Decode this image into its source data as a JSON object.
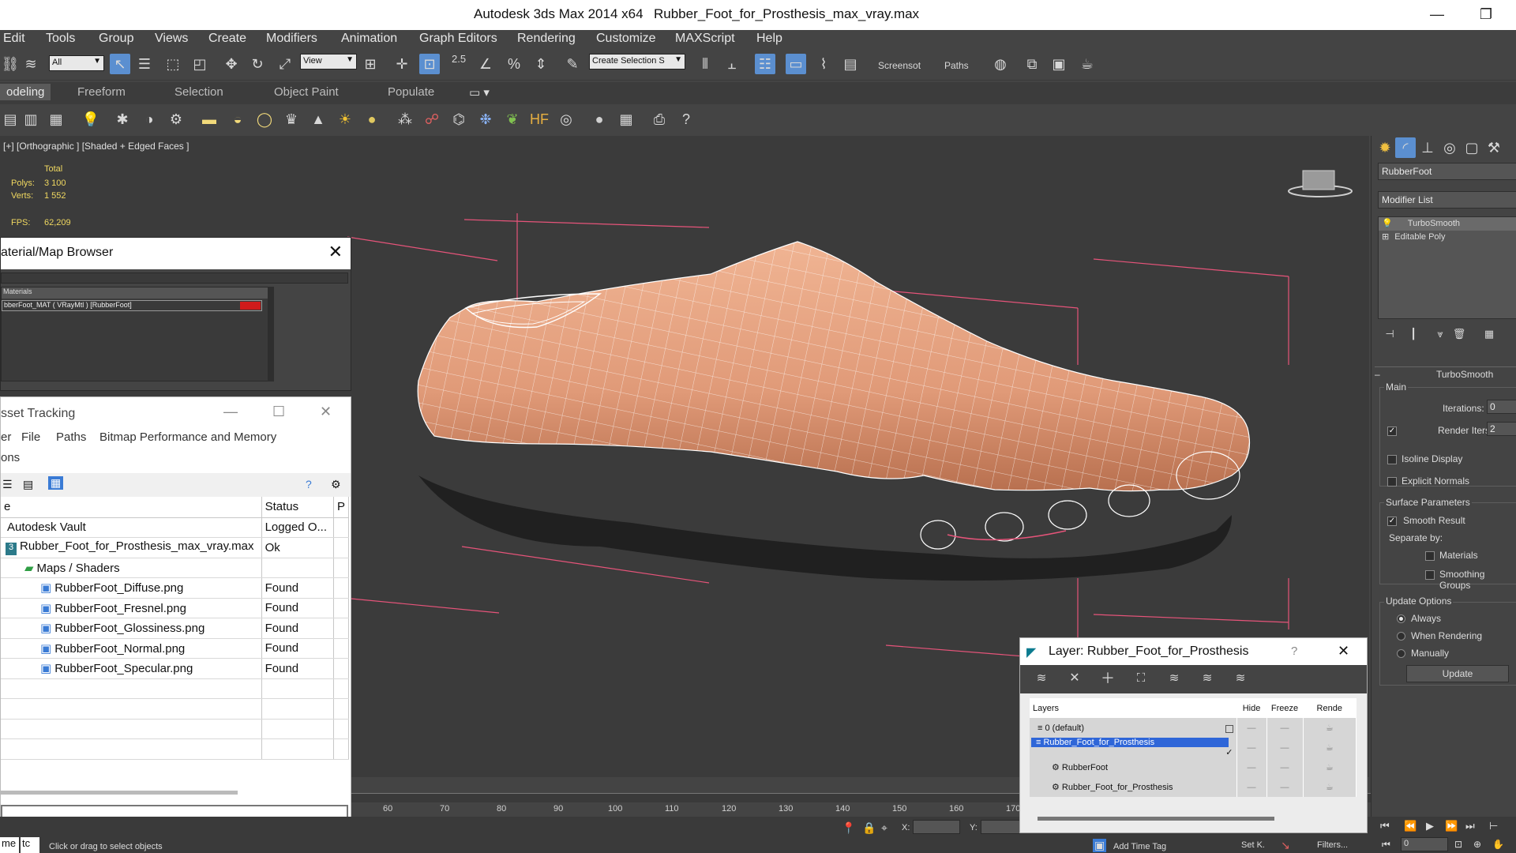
{
  "window": {
    "app_title": "Autodesk 3ds Max  2014 x64",
    "file_title": "Rubber_Foot_for_Prosthesis_max_vray.max",
    "minimize": "—",
    "maximize": "❐"
  },
  "menu": [
    "Edit",
    "Tools",
    "Group",
    "Views",
    "Create",
    "Modifiers",
    "Animation",
    "Graph Editors",
    "Rendering",
    "Customize",
    "MAXScript",
    "Help"
  ],
  "toolbar": {
    "selection_filter": "All",
    "reference_coord": "View",
    "named_selection": "Create Selection S",
    "snap_label": "2.5",
    "screenshot_label": "Screensot",
    "paths_label": "Paths"
  },
  "ribbon_tabs": [
    "odeling",
    "Freeform",
    "Selection",
    "Object Paint",
    "Populate"
  ],
  "viewport": {
    "label": "[+] [Orthographic ] [Shaded + Edged Faces ]",
    "stats": {
      "total_label": "Total",
      "polys_label": "Polys:",
      "polys_value": "3 100",
      "verts_label": "Verts:",
      "verts_value": "1 552",
      "fps_label": "FPS:",
      "fps_value": "62,209"
    }
  },
  "command_panel": {
    "object_name": "RubberFoot",
    "modifier_list": "Modifier List",
    "stack": [
      "TurboSmooth",
      "Editable Poly"
    ],
    "rollout_title": "TurboSmooth",
    "main_group": "Main",
    "iterations_label": "Iterations:",
    "iterations_value": "0",
    "render_iters_label": "Render Iters:",
    "render_iters_value": "2",
    "isoline_display": "Isoline Display",
    "explicit_normals": "Explicit Normals",
    "surface_group": "Surface Parameters",
    "smooth_result": "Smooth Result",
    "separate_by": "Separate by:",
    "materials": "Materials",
    "smoothing_groups": "Smoothing Groups",
    "update_group": "Update Options",
    "always": "Always",
    "when_rendering": "When Rendering",
    "manually": "Manually",
    "update_button": "Update"
  },
  "material_browser": {
    "title": "aterial/Map Browser",
    "section": "Materials",
    "item": "bberFoot_MAT ( VRayMtl ) [RubberFoot]"
  },
  "asset_tracking": {
    "title": "sset Tracking",
    "menu": [
      "er",
      "File",
      "Paths",
      "Bitmap Performance and Memory"
    ],
    "submenu": "ons",
    "col_name": "e",
    "col_status": "Status",
    "col_path": "P",
    "rows": [
      {
        "name": "Autodesk Vault",
        "status": "Logged O..."
      },
      {
        "name": "Rubber_Foot_for_Prosthesis_max_vray.max",
        "status": "Ok"
      },
      {
        "name": "Maps / Shaders",
        "status": ""
      },
      {
        "name": "RubberFoot_Diffuse.png",
        "status": "Found"
      },
      {
        "name": "RubberFoot_Fresnel.png",
        "status": "Found"
      },
      {
        "name": "RubberFoot_Glossiness.png",
        "status": "Found"
      },
      {
        "name": "RubberFoot_Normal.png",
        "status": "Found"
      },
      {
        "name": "RubberFoot_Specular.png",
        "status": "Found"
      }
    ]
  },
  "layer_dialog": {
    "title": "Layer: Rubber_Foot_for_Prosthesis",
    "help": "?",
    "close": "✕",
    "col_layers": "Layers",
    "col_hide": "Hide",
    "col_freeze": "Freeze",
    "col_render": "Rende",
    "rows": [
      "0 (default)",
      "Rubber_Foot_for_Prosthesis",
      "RubberFoot",
      "Rubber_Foot_for_Prosthesis"
    ]
  },
  "timeline": {
    "ticks": [
      "60",
      "70",
      "80",
      "90",
      "100",
      "110",
      "120",
      "130",
      "140",
      "150",
      "160",
      "170"
    ]
  },
  "status_bar": {
    "hint": "Click or drag to select objects",
    "maxscript_label": "me",
    "maxscript_label2": "tc",
    "x_label": "X:",
    "y_label": "Y:",
    "add_time_tag": "Add Time Tag",
    "set_k": "Set K.",
    "filters": "Filters...",
    "frame_value": "0"
  },
  "colors": {
    "ui_bg": "#444444",
    "viewport_bg": "#3b3b3b",
    "selection_blue": "#2f66d8",
    "mesh_skin": "#e39f7f",
    "bbox_pink": "#e6547a"
  }
}
